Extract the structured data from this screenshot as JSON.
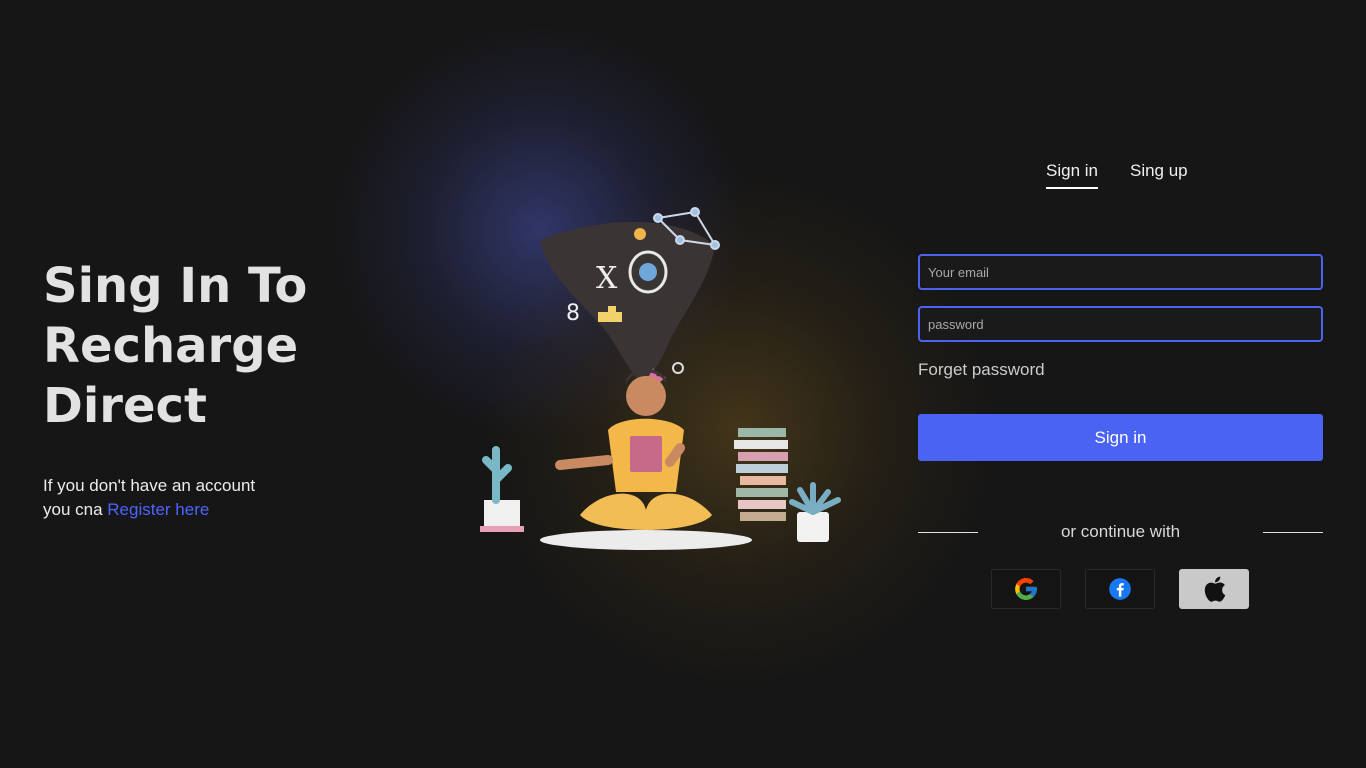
{
  "hero": {
    "title_line1": "Sing In To",
    "title_line2": "Recharge",
    "title_line3": "Direct",
    "subtext_line1": "If you don't have an account",
    "subtext_line2_prefix": "you cna ",
    "register_link": "Register here"
  },
  "tabs": [
    {
      "label": "Sign in",
      "active": true
    },
    {
      "label": "Sing up",
      "active": false
    }
  ],
  "form": {
    "email_placeholder": "Your email",
    "email_value": "",
    "password_placeholder": "password",
    "password_value": "",
    "forgot_label": "Forget password",
    "submit_label": "Sign in",
    "continue_label": "or continue with"
  },
  "social": [
    {
      "name": "google-icon"
    },
    {
      "name": "facebook-icon"
    },
    {
      "name": "apple-icon"
    }
  ],
  "colors": {
    "accent": "#4b63f3",
    "link": "#4d63ff",
    "background": "#161616"
  }
}
